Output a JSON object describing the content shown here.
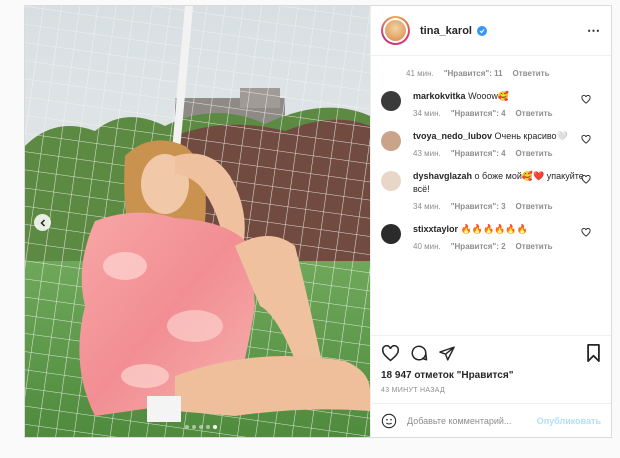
{
  "post": {
    "username": "tina_karol",
    "likes_text": "18 947 отметок \"Нравится\"",
    "posted": "43 МИНУТ НАЗАД",
    "carousel": {
      "slides": 5,
      "active": 5
    }
  },
  "comments": {
    "top_meta": {
      "time": "41 мин.",
      "likes": "\"Нравится\": 11",
      "reply": "Ответить"
    },
    "items": [
      {
        "user": "markokvitka",
        "text": "Wooow🥰",
        "time": "34 мин.",
        "likes": "\"Нравится\": 4",
        "reply": "Ответить",
        "avatar_color": "#3a3a3a"
      },
      {
        "user": "tvoya_nedo_lubov",
        "text": "Очень красиво🤍",
        "time": "43 мин.",
        "likes": "\"Нравится\": 4",
        "reply": "Ответить",
        "avatar_color": "#c9a48a"
      },
      {
        "user": "dyshavglazah",
        "text": "о боже мой🥰❤️ упакуйте всё!",
        "time": "34 мин.",
        "likes": "\"Нравится\": 3",
        "reply": "Ответить",
        "avatar_color": "#e8d7c8"
      },
      {
        "user": "stixxtaylor",
        "text": "🔥🔥🔥🔥🔥🔥",
        "time": "40 мин.",
        "likes": "\"Нравится\": 2",
        "reply": "Ответить",
        "avatar_color": "#2b2b2b"
      }
    ]
  },
  "compose": {
    "placeholder": "Добавьте комментарий...",
    "publish_label": "Опубликовать"
  },
  "colors": {
    "accent": "#3897f0",
    "publish_disabled": "#b2dffc",
    "muted": "#8e8e8e"
  }
}
